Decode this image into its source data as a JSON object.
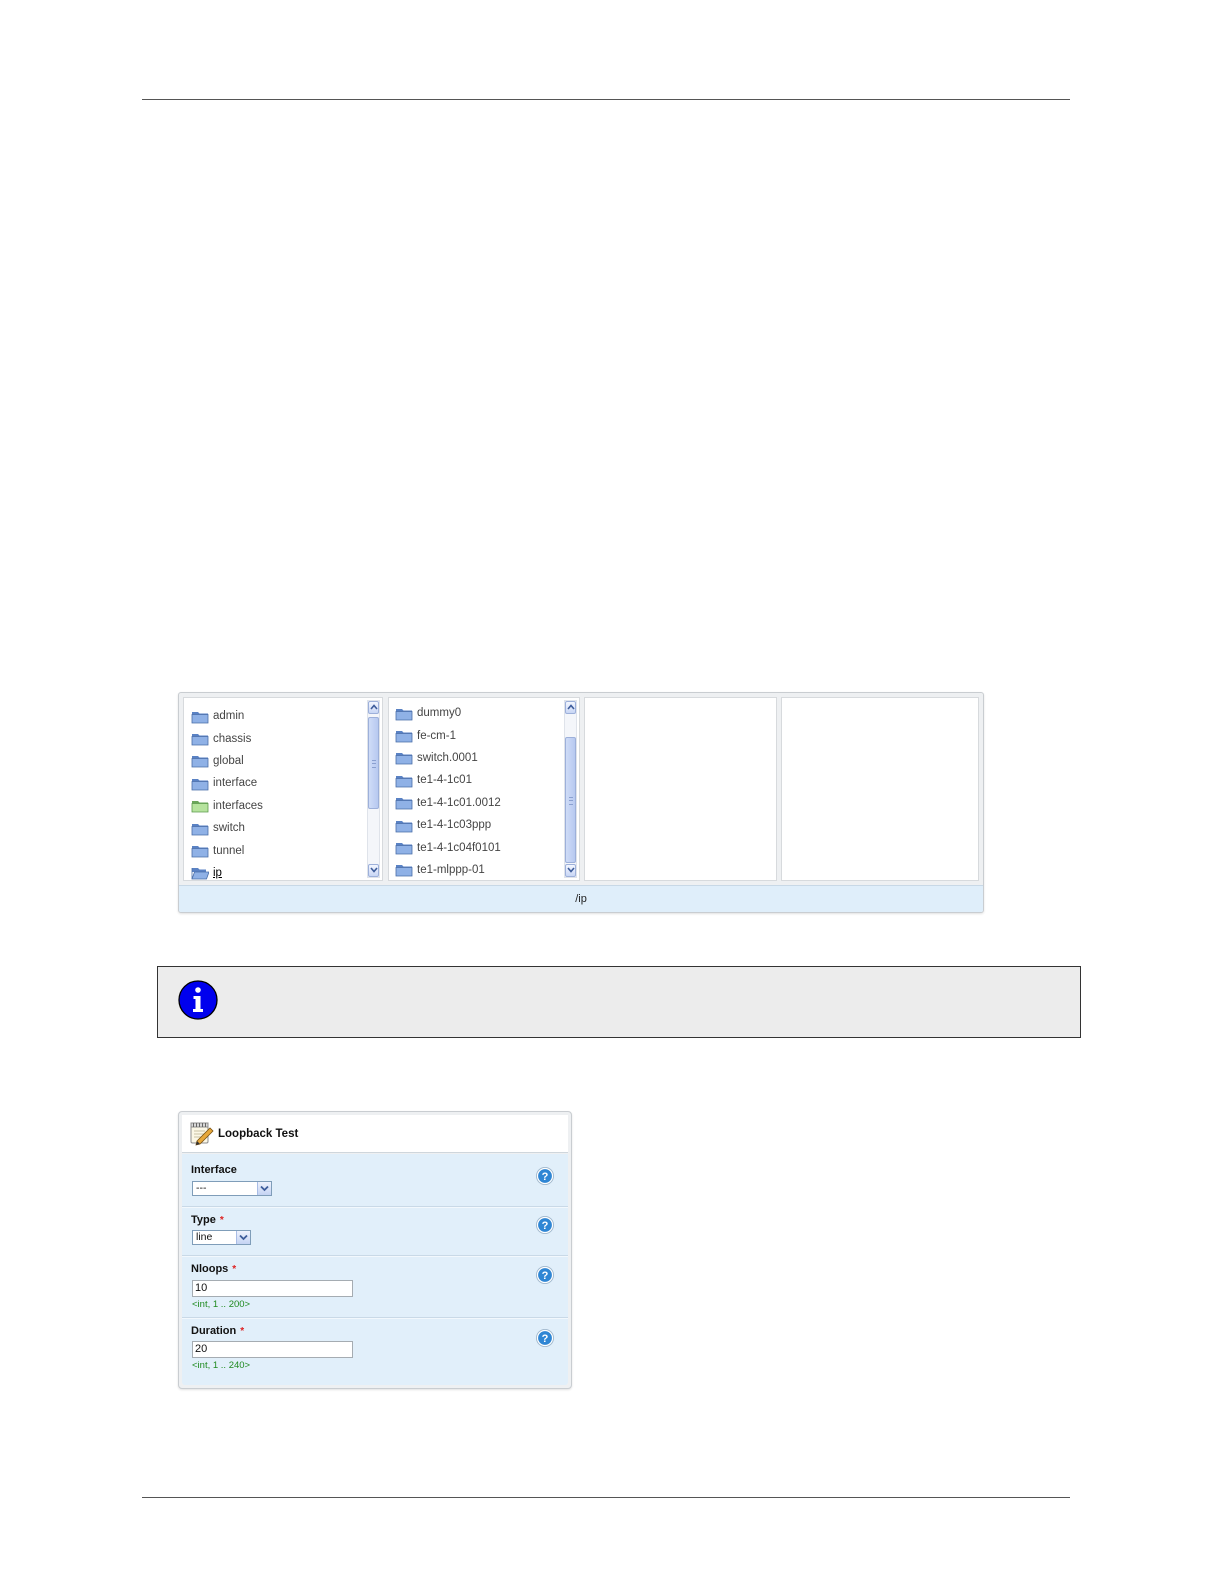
{
  "browser": {
    "columns": [
      {
        "items": [
          {
            "label": "admin",
            "folder": "blue"
          },
          {
            "label": "chassis",
            "folder": "blue"
          },
          {
            "label": "global",
            "folder": "blue"
          },
          {
            "label": "interface",
            "folder": "blue"
          },
          {
            "label": "interfaces",
            "folder": "green"
          },
          {
            "label": "switch",
            "folder": "blue"
          },
          {
            "label": "tunnel",
            "folder": "blue"
          },
          {
            "label": "ip",
            "folder": "open",
            "selected": true
          }
        ]
      },
      {
        "items": [
          {
            "label": "dummy0",
            "folder": "blue"
          },
          {
            "label": "fe-cm-1",
            "folder": "blue"
          },
          {
            "label": "switch.0001",
            "folder": "blue"
          },
          {
            "label": "te1-4-1c01",
            "folder": "blue"
          },
          {
            "label": "te1-4-1c01.0012",
            "folder": "blue"
          },
          {
            "label": "te1-4-1c03ppp",
            "folder": "blue"
          },
          {
            "label": "te1-4-1c04f0101",
            "folder": "blue"
          },
          {
            "label": "te1-mlppp-01",
            "folder": "blue"
          }
        ]
      },
      {
        "items": []
      },
      {
        "items": []
      }
    ],
    "path": "/ip"
  },
  "loopback": {
    "title": "Loopback Test",
    "fields": {
      "interface": {
        "label": "Interface",
        "value": "---"
      },
      "type": {
        "label": "Type",
        "required_mark": "*",
        "value": "line"
      },
      "nloops": {
        "label": "Nloops",
        "required_mark": "*",
        "value": "10",
        "hint": "<int, 1 .. 200>"
      },
      "duration": {
        "label": "Duration",
        "required_mark": "*",
        "value": "20",
        "hint": "<int, 1 .. 240>"
      }
    }
  },
  "colors": {
    "panel_body": "#e1effa",
    "path_bar": "#dfeefa",
    "info_box": "#ececec",
    "info_icon": "#0000ee",
    "hint_text": "#1f8a1f",
    "required": "#dd2222"
  }
}
